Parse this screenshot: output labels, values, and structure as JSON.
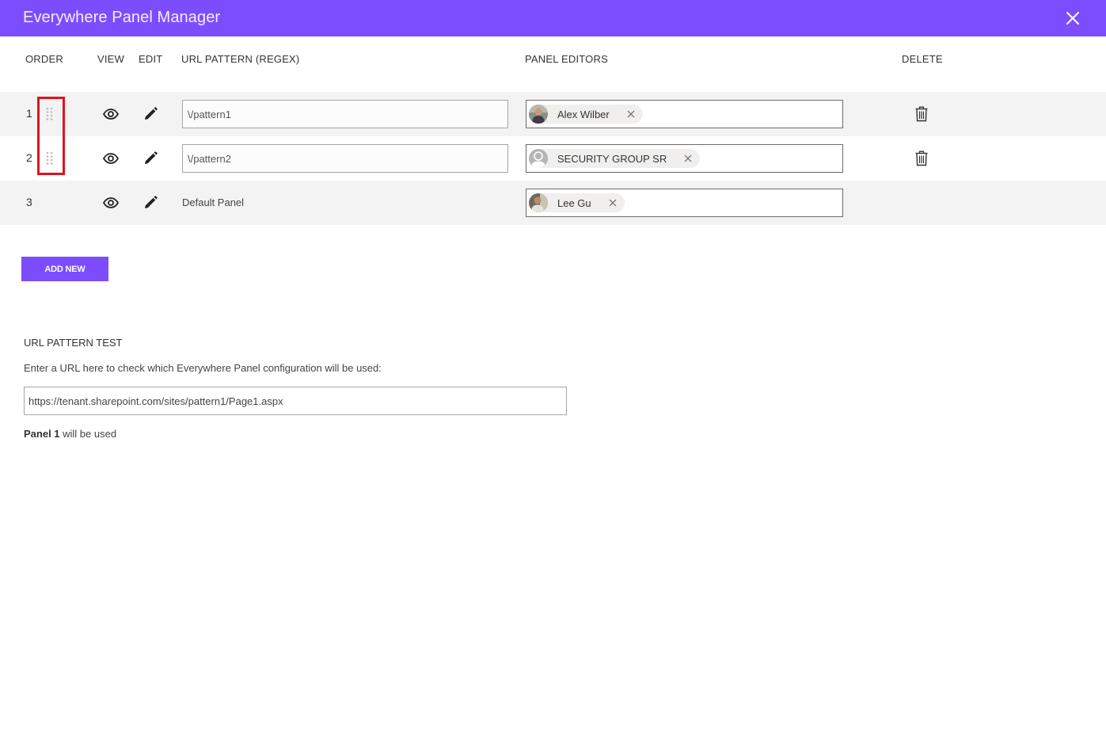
{
  "window": {
    "title": "Everywhere Panel Manager",
    "close_icon": "close-icon",
    "accent_color": "#7c4dff"
  },
  "columns": {
    "order": "ORDER",
    "view": "VIEW",
    "edit": "EDIT",
    "url_pattern": "URL PATTERN (REGEX)",
    "panel_editors": "PANEL EDITORS",
    "delete": "DELETE"
  },
  "rows": [
    {
      "order": "1",
      "draggable": true,
      "url_pattern": "\\/pattern1",
      "is_default": false,
      "editor": {
        "name": "Alex Wilber",
        "avatar": "photo"
      },
      "deletable": true
    },
    {
      "order": "2",
      "draggable": true,
      "url_pattern": "\\/pattern2",
      "is_default": false,
      "editor": {
        "name": "SECURITY GROUP SR",
        "avatar": "placeholder"
      },
      "deletable": true
    },
    {
      "order": "3",
      "draggable": false,
      "url_pattern": "Default Panel",
      "is_default": true,
      "editor": {
        "name": "Lee Gu",
        "avatar": "photo"
      },
      "deletable": false
    }
  ],
  "add_new_label": "ADD NEW",
  "url_test": {
    "heading": "URL PATTERN TEST",
    "description": "Enter a URL here to check which Everywhere Panel configuration will be used:",
    "input_value": "https://tenant.sharepoint.com/sites/pattern1/Page1.aspx",
    "result_bold": "Panel 1",
    "result_rest": " will be used"
  },
  "highlight_color": "#e0121e"
}
